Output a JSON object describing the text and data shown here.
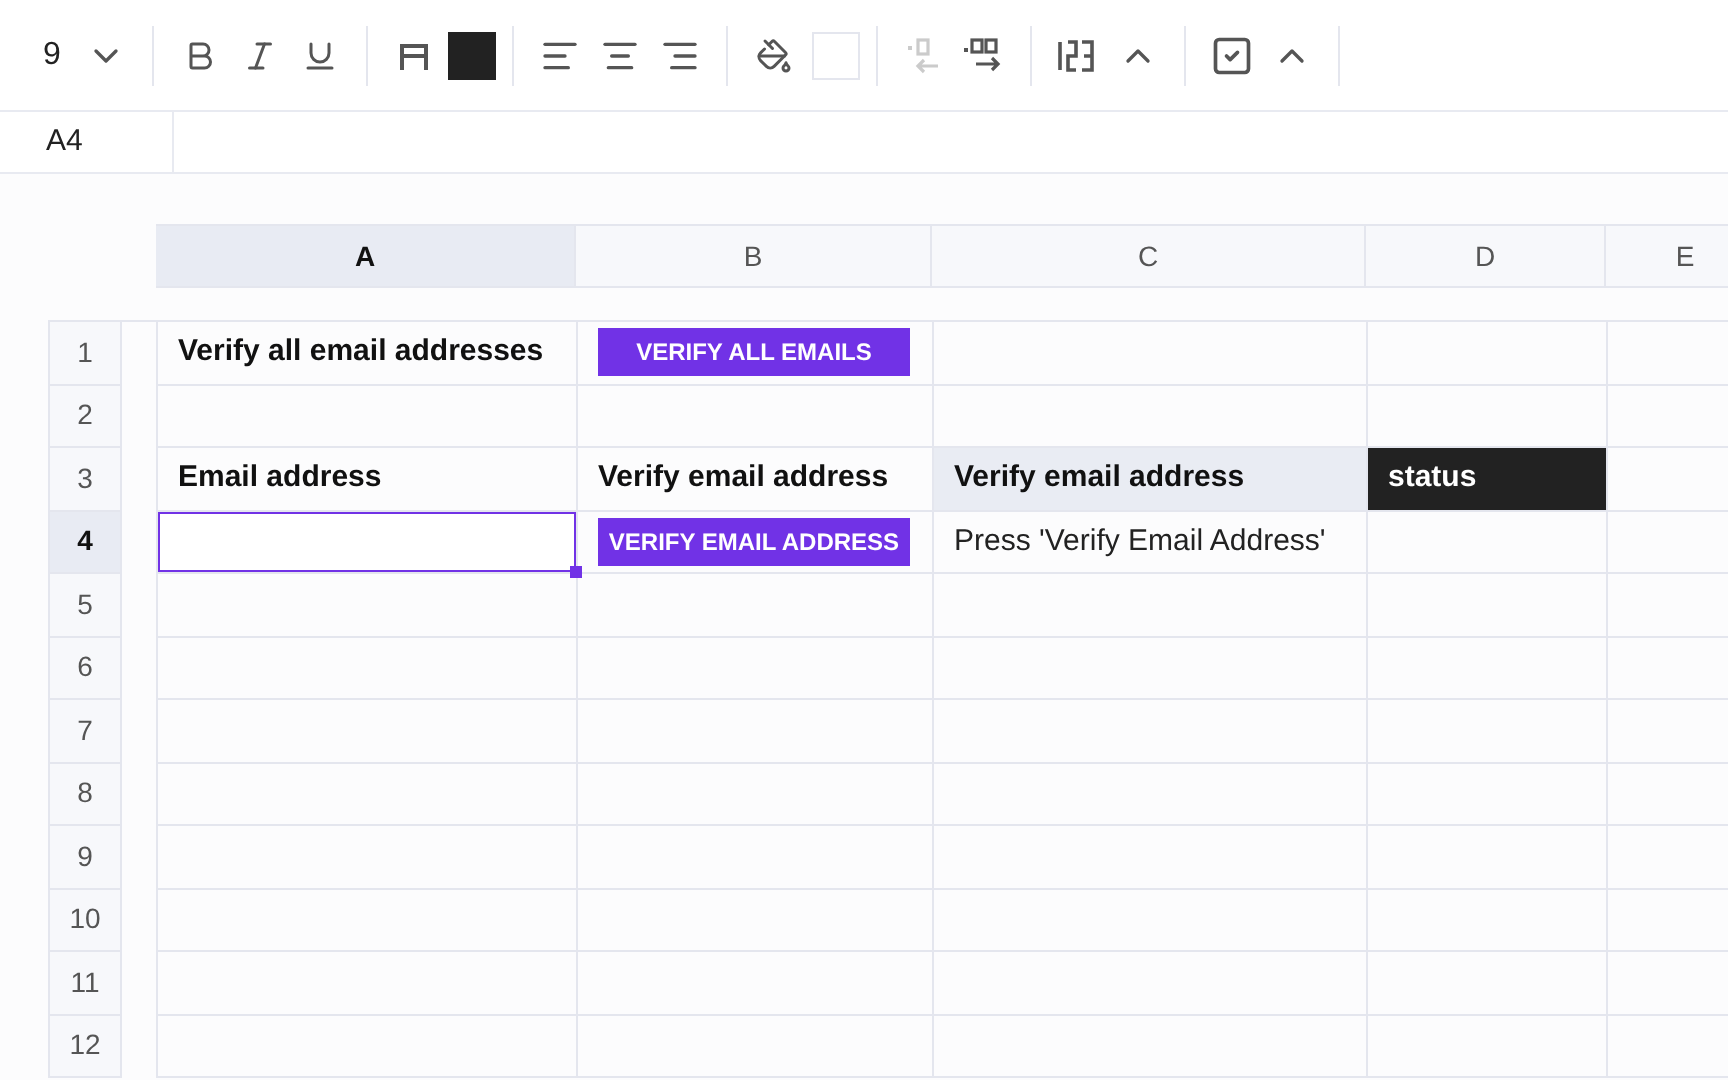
{
  "toolbar": {
    "font_size": "9",
    "decrease_decimals_disabled": true
  },
  "name_box": "A4",
  "columns": [
    {
      "label": "A",
      "selected": true
    },
    {
      "label": "B",
      "selected": false
    },
    {
      "label": "C",
      "selected": false
    },
    {
      "label": "D",
      "selected": false
    },
    {
      "label": "E",
      "selected": false
    }
  ],
  "rows": [
    {
      "number": "1",
      "selected": false,
      "cells": [
        {
          "kind": "label",
          "text": "Verify all email addresses"
        },
        {
          "kind": "button",
          "text": "VERIFY ALL EMAILS"
        },
        {
          "kind": "empty"
        },
        {
          "kind": "empty"
        },
        {
          "kind": "empty"
        }
      ]
    },
    {
      "number": "2",
      "selected": false,
      "cells": [
        {
          "kind": "empty"
        },
        {
          "kind": "empty"
        },
        {
          "kind": "empty"
        },
        {
          "kind": "empty"
        },
        {
          "kind": "empty"
        }
      ]
    },
    {
      "number": "3",
      "selected": false,
      "cells": [
        {
          "kind": "label",
          "text": "Email address"
        },
        {
          "kind": "label",
          "text": "Verify email address"
        },
        {
          "kind": "shaded-label",
          "text": "Verify email address"
        },
        {
          "kind": "dark-label",
          "text": "status"
        },
        {
          "kind": "empty"
        }
      ]
    },
    {
      "number": "4",
      "selected": true,
      "cells": [
        {
          "kind": "active"
        },
        {
          "kind": "button",
          "text": "VERIFY EMAIL ADDRESS"
        },
        {
          "kind": "text",
          "text": "Press 'Verify Email Address'"
        },
        {
          "kind": "empty"
        },
        {
          "kind": "empty"
        }
      ]
    },
    {
      "number": "5",
      "selected": false,
      "cells": [
        {
          "kind": "empty"
        },
        {
          "kind": "empty"
        },
        {
          "kind": "empty"
        },
        {
          "kind": "empty"
        },
        {
          "kind": "empty"
        }
      ]
    },
    {
      "number": "6",
      "selected": false,
      "cells": [
        {
          "kind": "empty"
        },
        {
          "kind": "empty"
        },
        {
          "kind": "empty"
        },
        {
          "kind": "empty"
        },
        {
          "kind": "empty"
        }
      ]
    },
    {
      "number": "7",
      "selected": false,
      "cells": [
        {
          "kind": "empty"
        },
        {
          "kind": "empty"
        },
        {
          "kind": "empty"
        },
        {
          "kind": "empty"
        },
        {
          "kind": "empty"
        }
      ]
    },
    {
      "number": "8",
      "selected": false,
      "cells": [
        {
          "kind": "empty"
        },
        {
          "kind": "empty"
        },
        {
          "kind": "empty"
        },
        {
          "kind": "empty"
        },
        {
          "kind": "empty"
        }
      ]
    },
    {
      "number": "9",
      "selected": false,
      "cells": [
        {
          "kind": "empty"
        },
        {
          "kind": "empty"
        },
        {
          "kind": "empty"
        },
        {
          "kind": "empty"
        },
        {
          "kind": "empty"
        }
      ]
    },
    {
      "number": "10",
      "selected": false,
      "cells": [
        {
          "kind": "empty"
        },
        {
          "kind": "empty"
        },
        {
          "kind": "empty"
        },
        {
          "kind": "empty"
        },
        {
          "kind": "empty"
        }
      ]
    },
    {
      "number": "11",
      "selected": false,
      "cells": [
        {
          "kind": "empty"
        },
        {
          "kind": "empty"
        },
        {
          "kind": "empty"
        },
        {
          "kind": "empty"
        },
        {
          "kind": "empty"
        }
      ]
    },
    {
      "number": "12",
      "selected": false,
      "cells": [
        {
          "kind": "empty"
        },
        {
          "kind": "empty"
        },
        {
          "kind": "empty"
        },
        {
          "kind": "empty"
        },
        {
          "kind": "empty"
        }
      ]
    }
  ]
}
